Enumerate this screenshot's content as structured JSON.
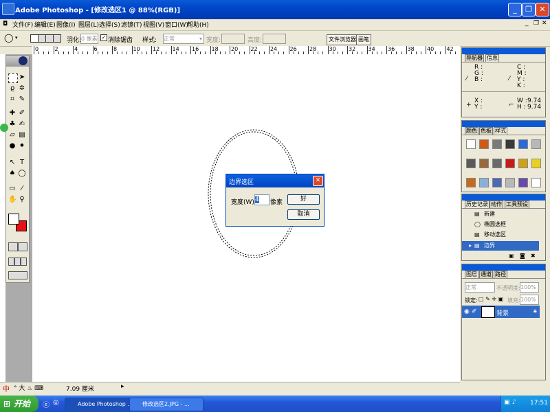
{
  "window": {
    "title": "Adobe Photoshop - [修改选区1 @ 88%(RGB)]"
  },
  "menu": [
    "文件(F)",
    "编辑(E)",
    "图像(I)",
    "图层(L)",
    "选择(S)",
    "滤镜(T)",
    "视图(V)",
    "窗口(W)",
    "帮助(H)"
  ],
  "options": {
    "feather_label": "羽化:",
    "feather_value": "0 像素",
    "antialias_label": "消除锯齿",
    "style_label": "样式:",
    "style_value": "正常",
    "width_label": "宽度:",
    "height_label": "高度:",
    "tab_file_browser": "文件浏览器",
    "tab_brushes": "画笔"
  },
  "ruler_top_labels": [
    "0",
    "2",
    "4",
    "6",
    "8",
    "10",
    "12",
    "14",
    "16",
    "18",
    "20",
    "22",
    "24",
    "26",
    "28",
    "30",
    "32",
    "34",
    "36",
    "38",
    "40",
    "42"
  ],
  "dialog": {
    "title": "边界选区",
    "width_label": "宽度(W):",
    "width_value": "4",
    "unit": "像素",
    "ok": "好",
    "cancel": "取消"
  },
  "panels": {
    "nav_info": {
      "tabs": [
        "导航器",
        "信息"
      ],
      "rgb": [
        "R :",
        "G :",
        "B :"
      ],
      "cmyk": [
        "C :",
        "M :",
        "Y :",
        "K :"
      ],
      "xy": [
        "X :",
        "Y :"
      ],
      "w_label": "W :",
      "w_value": "9.74",
      "h_label": "H :",
      "h_value": "9.74"
    },
    "swatches_styles": {
      "tabs": [
        "颜色",
        "色板",
        "样式"
      ]
    },
    "history": {
      "tabs": [
        "历史记录",
        "动作",
        "工具预设"
      ],
      "items": [
        "新建",
        "椭圆选框",
        "移动选区",
        "边界"
      ]
    },
    "layers": {
      "tabs": [
        "图层",
        "通道",
        "路径"
      ],
      "blend_mode": "正常",
      "opacity_label": "不透明度:",
      "opacity_value": "100%",
      "lock_label": "锁定:",
      "fill_label": "填充:",
      "fill_value": "100%",
      "layer_name": "背景"
    }
  },
  "statusbar": {
    "ime": "中",
    "size": "7.09 厘米"
  },
  "taskbar": {
    "start": "开始",
    "tasks": [
      "Adobe Photoshop ...",
      "修改选区2.JPG - ..."
    ],
    "clock": "17:51"
  },
  "colors": {
    "xp_blue": "#0a5ad8",
    "foreground": "#ffffff",
    "background": "#e81010",
    "selection_highlight": "#316ac5"
  }
}
